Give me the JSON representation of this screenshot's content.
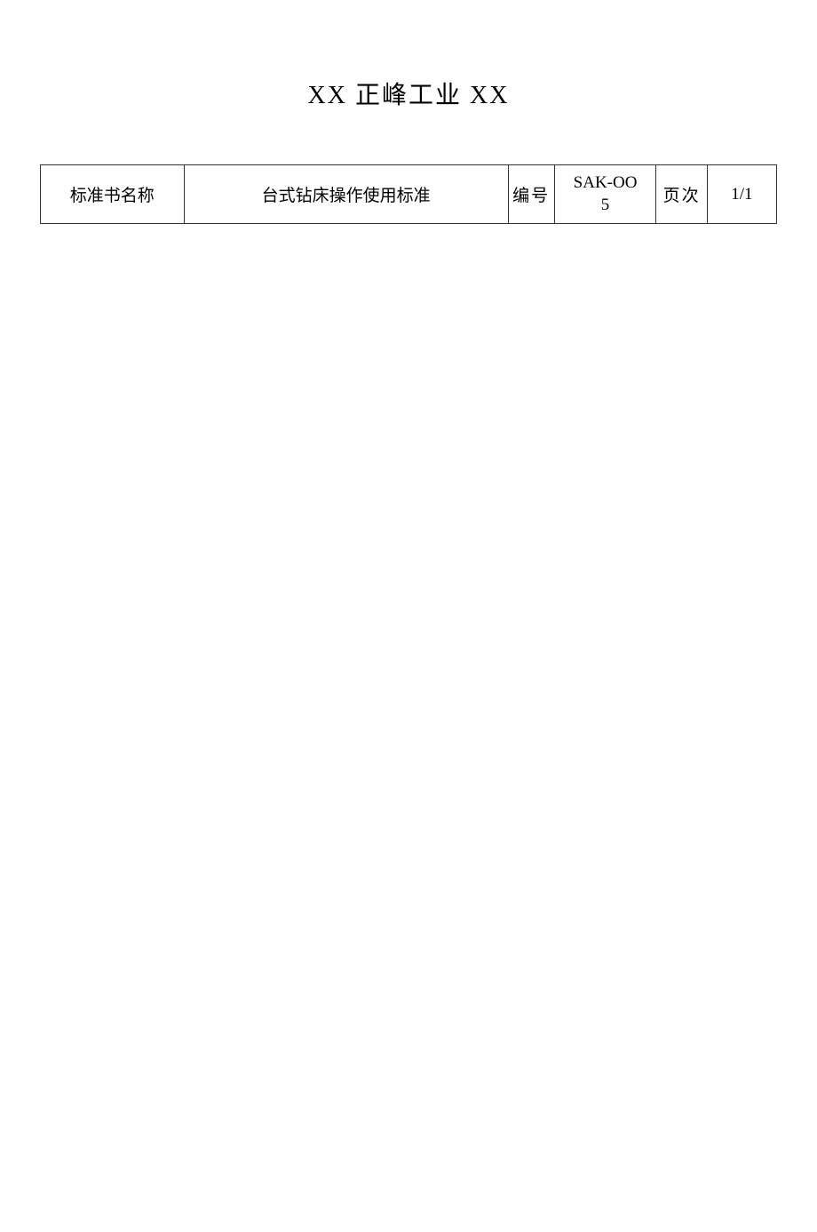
{
  "title": "XX 正峰工业 XX",
  "header_row": {
    "label1": "标准书名称",
    "value1": "台式钻床操作使用标准",
    "label2": "编号",
    "value2_line1": "SAK-OO",
    "value2_line2": "5",
    "label3": "页次",
    "value3": "1/1"
  }
}
